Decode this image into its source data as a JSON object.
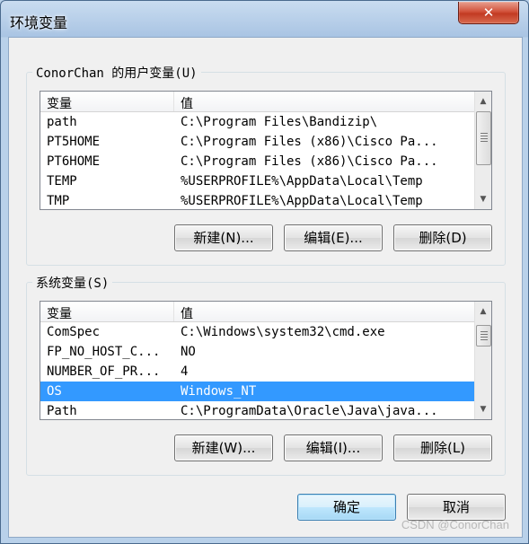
{
  "window": {
    "title": "环境变量",
    "close_label": "✕"
  },
  "user_vars": {
    "group_label": "ConorChan 的用户变量(U)",
    "col_var": "变量",
    "col_val": "值",
    "rows": [
      {
        "name": "path",
        "value": "C:\\Program Files\\Bandizip\\"
      },
      {
        "name": "PT5HOME",
        "value": "C:\\Program Files (x86)\\Cisco Pa..."
      },
      {
        "name": "PT6HOME",
        "value": "C:\\Program Files (x86)\\Cisco Pa..."
      },
      {
        "name": "TEMP",
        "value": "%USERPROFILE%\\AppData\\Local\\Temp"
      },
      {
        "name": "TMP",
        "value": "%USERPROFILE%\\AppData\\Local\\Temp"
      }
    ],
    "new_button": "新建(N)...",
    "edit_button": "编辑(E)...",
    "delete_button": "删除(D)"
  },
  "system_vars": {
    "group_label": "系统变量(S)",
    "col_var": "变量",
    "col_val": "值",
    "rows": [
      {
        "name": "ComSpec",
        "value": "C:\\Windows\\system32\\cmd.exe"
      },
      {
        "name": "FP_NO_HOST_C...",
        "value": "NO"
      },
      {
        "name": "NUMBER_OF_PR...",
        "value": "4"
      },
      {
        "name": "OS",
        "value": "Windows_NT"
      },
      {
        "name": "Path",
        "value": "C:\\ProgramData\\Oracle\\Java\\java..."
      }
    ],
    "selected_row": "OS",
    "new_button": "新建(W)...",
    "edit_button": "编辑(I)...",
    "delete_button": "删除(L)"
  },
  "ok_button": "确定",
  "cancel_button": "取消",
  "watermark": "CSDN @ConorChan",
  "colors": {
    "selection": "#3399ff",
    "title_bar": "#a9c4e3",
    "close_button": "#c23a22"
  },
  "icons": [
    "close-icon",
    "scroll-up-icon",
    "scroll-down-icon"
  ]
}
